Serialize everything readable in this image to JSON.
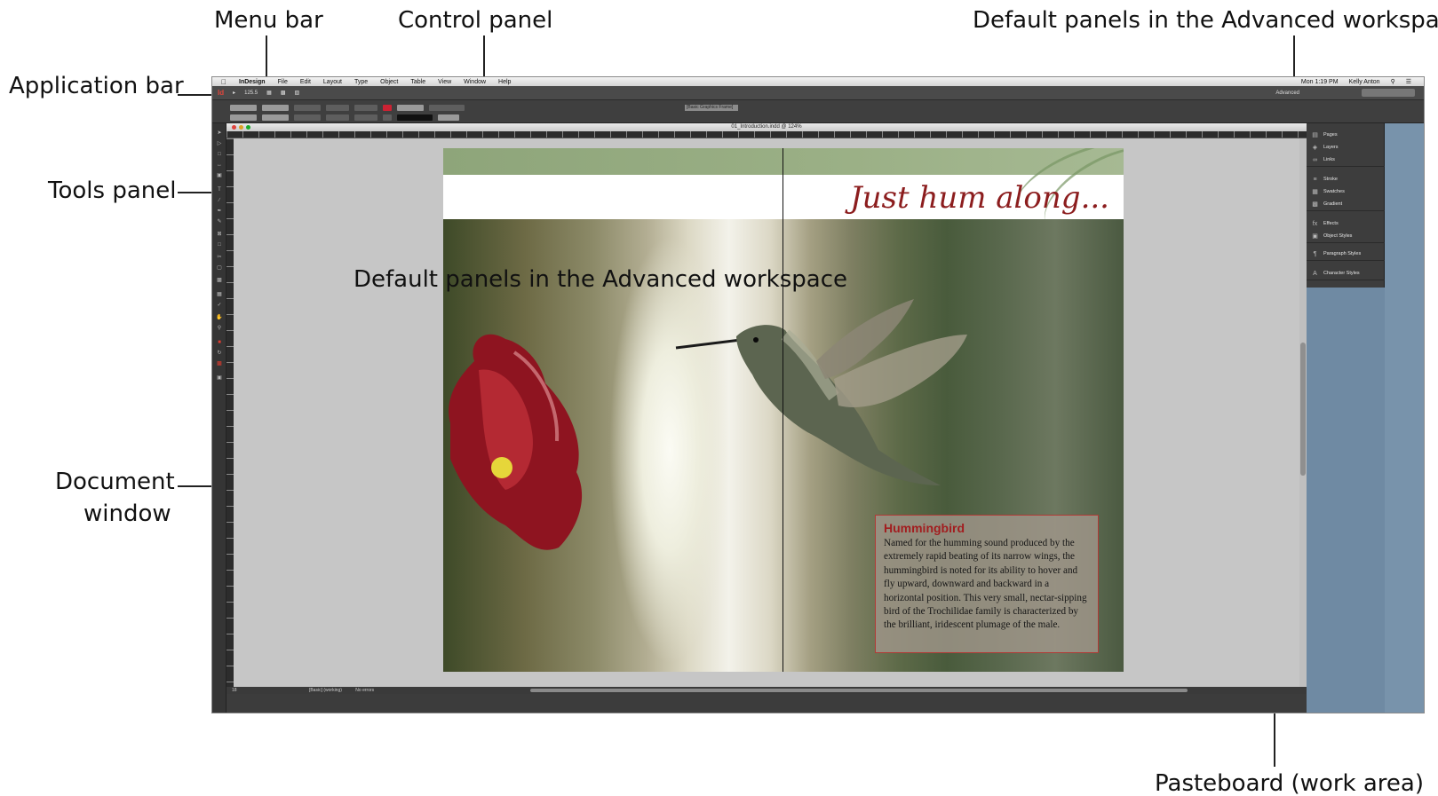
{
  "callouts": {
    "menu_bar": "Menu bar",
    "control_panel": "Control panel",
    "default_panels_top": "Default panels in the Advanced workspace",
    "application_bar": "Application bar",
    "tools_panel": "Tools panel",
    "document_window_line1": "Document",
    "document_window_line2": "window",
    "pasteboard": "Pasteboard (work area)",
    "default_panels_overlay": "Default panels in the Advanced workspace"
  },
  "menubar": {
    "apple_icon": "apple-icon",
    "app_name": "InDesign",
    "items": [
      "File",
      "Edit",
      "Layout",
      "Type",
      "Object",
      "Table",
      "View",
      "Window",
      "Help"
    ],
    "clock": "Mon 1:19 PM",
    "user": "Kelly Anton"
  },
  "appbar": {
    "logo": "Id",
    "zoom": "125.5",
    "workspace": "Advanced"
  },
  "control": {
    "frame_style": "[Basic Graphics Frame]"
  },
  "document": {
    "title": "01_Introduction.indd @ 124%",
    "status_page": "18",
    "status_profile": "[Basic] (working)",
    "status_errors": "No errors"
  },
  "spread": {
    "headline": "Just hum along...",
    "info_title": "Hummingbird",
    "info_body": "Named for the humming sound produced by the extremely rapid beating of its narrow wings, the hummingbird is noted for its ability to hover and fly upward, downward and backward in a horizontal position. This very small, nectar-sipping bird of the Trochilidae family is characterized by the brilliant, iridescent plumage of the male."
  },
  "panels": {
    "groups": [
      [
        {
          "label": "Pages",
          "icon": "pages-icon"
        },
        {
          "label": "Layers",
          "icon": "layers-icon"
        },
        {
          "label": "Links",
          "icon": "links-icon"
        }
      ],
      [
        {
          "label": "Stroke",
          "icon": "stroke-icon"
        },
        {
          "label": "Swatches",
          "icon": "swatches-icon"
        },
        {
          "label": "Gradient",
          "icon": "gradient-icon"
        }
      ],
      [
        {
          "label": "Effects",
          "icon": "effects-icon"
        },
        {
          "label": "Object Styles",
          "icon": "object-styles-icon"
        }
      ],
      [
        {
          "label": "Paragraph Styles",
          "icon": "paragraph-styles-icon"
        }
      ],
      [
        {
          "label": "Character Styles",
          "icon": "character-styles-icon"
        }
      ]
    ]
  },
  "colors": {
    "headline_red": "#8c1d1e",
    "band_green": "#9bb086",
    "pasteboard_gray": "#c6c6c6",
    "panel_blue": "#7893ab"
  }
}
